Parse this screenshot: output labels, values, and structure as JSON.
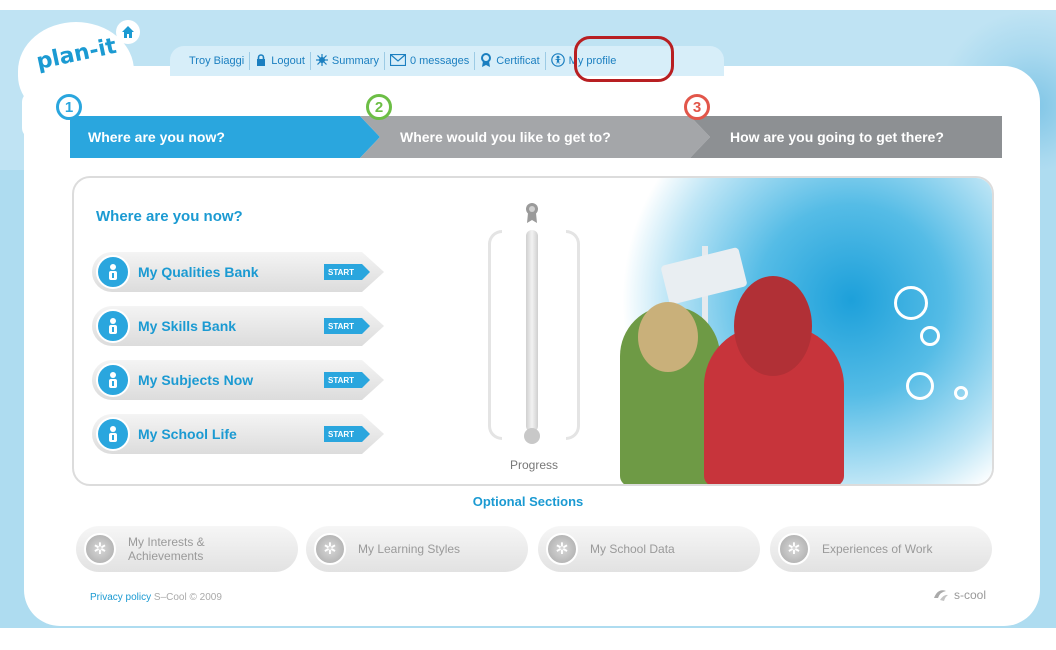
{
  "app": {
    "logo_text": "plan-it"
  },
  "nav": {
    "user_name": "Troy Biaggi",
    "logout": "Logout",
    "summary": "Summary",
    "messages": "0 messages",
    "certificate": "Certificat",
    "my_profile": "My profile"
  },
  "steps": [
    {
      "number": "1",
      "label": "Where are you now?",
      "color": "#2aa6de"
    },
    {
      "number": "2",
      "label": "Where would you like to get to?",
      "color": "#6cbe45"
    },
    {
      "number": "3",
      "label": "How are you going to get there?",
      "color": "#e2564a"
    }
  ],
  "panel": {
    "title": "Where are you now?",
    "sections": [
      {
        "label": "My Qualities Bank",
        "action": "START"
      },
      {
        "label": "My Skills Bank",
        "action": "START"
      },
      {
        "label": "My Subjects Now",
        "action": "START"
      },
      {
        "label": "My School Life",
        "action": "START"
      }
    ],
    "progress_label": "Progress"
  },
  "optional": {
    "title": "Optional Sections",
    "items": [
      {
        "label": "My Interests & Achievements"
      },
      {
        "label": "My Learning Styles"
      },
      {
        "label": "My School Data"
      },
      {
        "label": "Experiences of Work"
      }
    ]
  },
  "footer": {
    "privacy": "Privacy policy",
    "copyright": "S–Cool © 2009",
    "brand": "s-cool"
  }
}
